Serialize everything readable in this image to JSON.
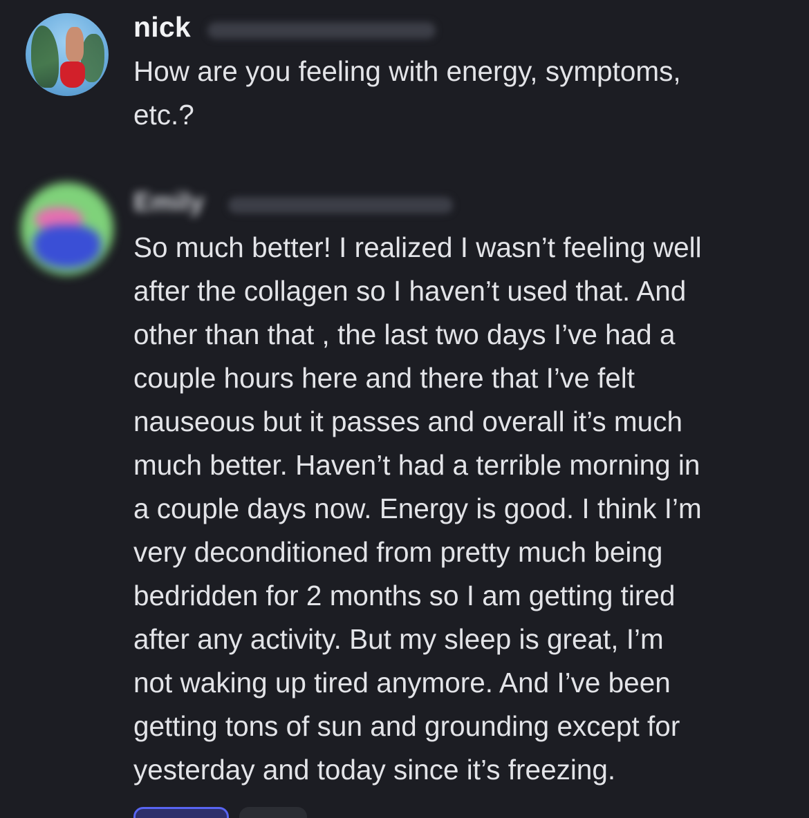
{
  "messages": [
    {
      "username": "nick",
      "text": "How are you feeling with energy, symptoms,\netc.?"
    },
    {
      "username": "Emily",
      "text": "So much better! I realized I wasn’t feeling well\nafter the collagen so I haven’t used that. And\nother than that , the last two days I’ve had a\ncouple hours here and there that I’ve felt\nnauseous but it passes and overall it’s much\nmuch better. Haven’t had a terrible morning in\na couple days now. Energy is good. I think I’m\nvery deconditioned from pretty much being\nbedridden for 2 months so I am getting tired\nafter any activity. But my sleep is great, I’m\nnot waking up tired anymore. And I’ve been\ngetting tons of sun and grounding except for\nyesterday and today since it’s freezing."
    }
  ],
  "colors": {
    "background": "#1c1d23",
    "text": "#e3e4e8",
    "username": "#f2f3f5",
    "reaction_active_border": "#5865f2"
  }
}
